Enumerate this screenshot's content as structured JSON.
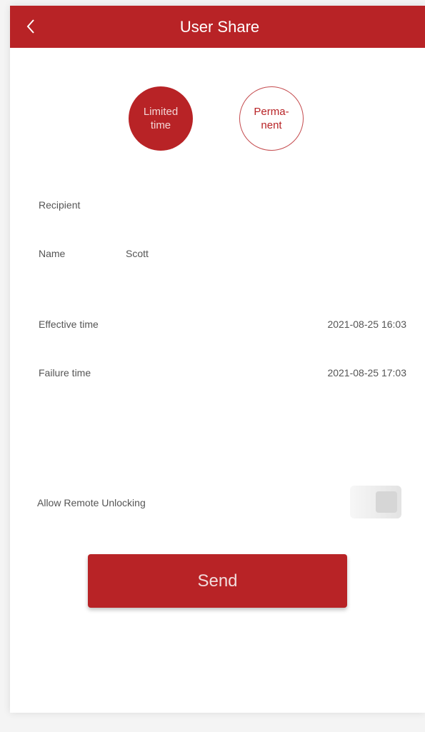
{
  "header": {
    "title": "User Share",
    "back_icon": "chevron-left-icon"
  },
  "share_mode": {
    "options": [
      {
        "label": "Limited\ntime",
        "selected": true
      },
      {
        "label": "Perma-\nnent",
        "selected": false
      }
    ]
  },
  "form": {
    "recipient_label": "Recipient",
    "recipient_value": "",
    "name_label": "Name",
    "name_value": "Scott",
    "effective_label": "Effective time",
    "effective_value": "2021-08-25 16:03",
    "failure_label": "Failure time",
    "failure_value": "2021-08-25 17:03",
    "remote_unlock_label": "Allow Remote Unlocking"
  },
  "actions": {
    "send_label": "Send"
  },
  "colors": {
    "accent": "#b82326"
  }
}
